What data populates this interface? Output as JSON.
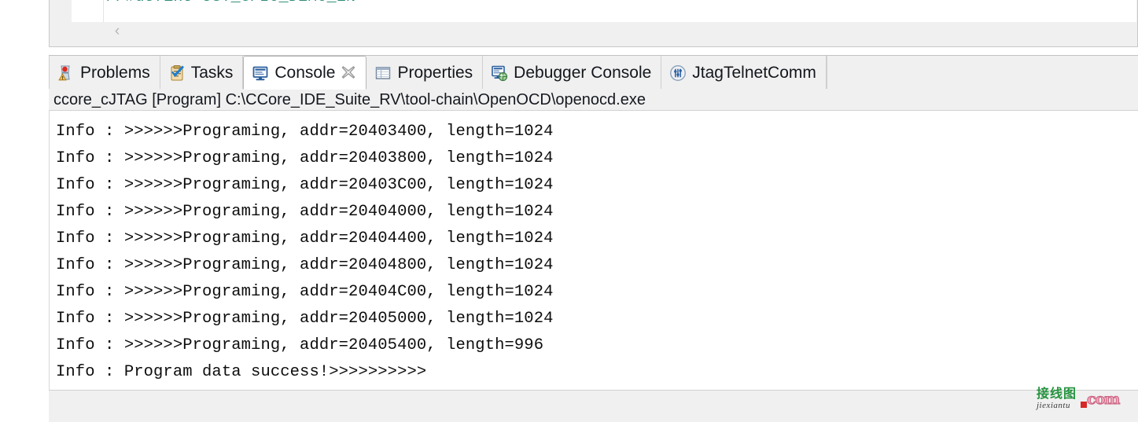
{
  "editor": {
    "code_line": "//#define UST_GPIO_DEMO_EN",
    "collapse_chevron": "‹",
    "comment_color": "#2e8b76"
  },
  "console_view": {
    "tabs": [
      {
        "label": "Problems",
        "icon": "problems-icon",
        "active": false,
        "closable": false
      },
      {
        "label": "Tasks",
        "icon": "tasks-icon",
        "active": false,
        "closable": false
      },
      {
        "label": "Console",
        "icon": "console-icon",
        "active": true,
        "closable": true,
        "close_glyph": "✖"
      },
      {
        "label": "Properties",
        "icon": "properties-icon",
        "active": false,
        "closable": false
      },
      {
        "label": "Debugger Console",
        "icon": "debugger-console-icon",
        "active": false,
        "closable": false
      },
      {
        "label": "JtagTelnetComm",
        "icon": "jtag-telnet-comm-icon",
        "active": false,
        "closable": false
      }
    ],
    "title": "ccore_cJTAG [Program] C:\\CCore_IDE_Suite_RV\\tool-chain\\OpenOCD\\openocd.exe",
    "output_lines": [
      "Info : >>>>>>Programing, addr=20403400, length=1024",
      "Info : >>>>>>Programing, addr=20403800, length=1024",
      "Info : >>>>>>Programing, addr=20403C00, length=1024",
      "Info : >>>>>>Programing, addr=20404000, length=1024",
      "Info : >>>>>>Programing, addr=20404400, length=1024",
      "Info : >>>>>>Programing, addr=20404800, length=1024",
      "Info : >>>>>>Programing, addr=20404C00, length=1024",
      "Info : >>>>>>Programing, addr=20405000, length=1024",
      "Info : >>>>>>Programing, addr=20405400, length=996",
      "Info : Program data success!>>>>>>>>>>"
    ]
  },
  "watermark": {
    "chinese": "接线图",
    "pinyin": "jiexiantu",
    "tld": "com",
    "green": "#25923f",
    "pink": "#f1a6bb"
  }
}
